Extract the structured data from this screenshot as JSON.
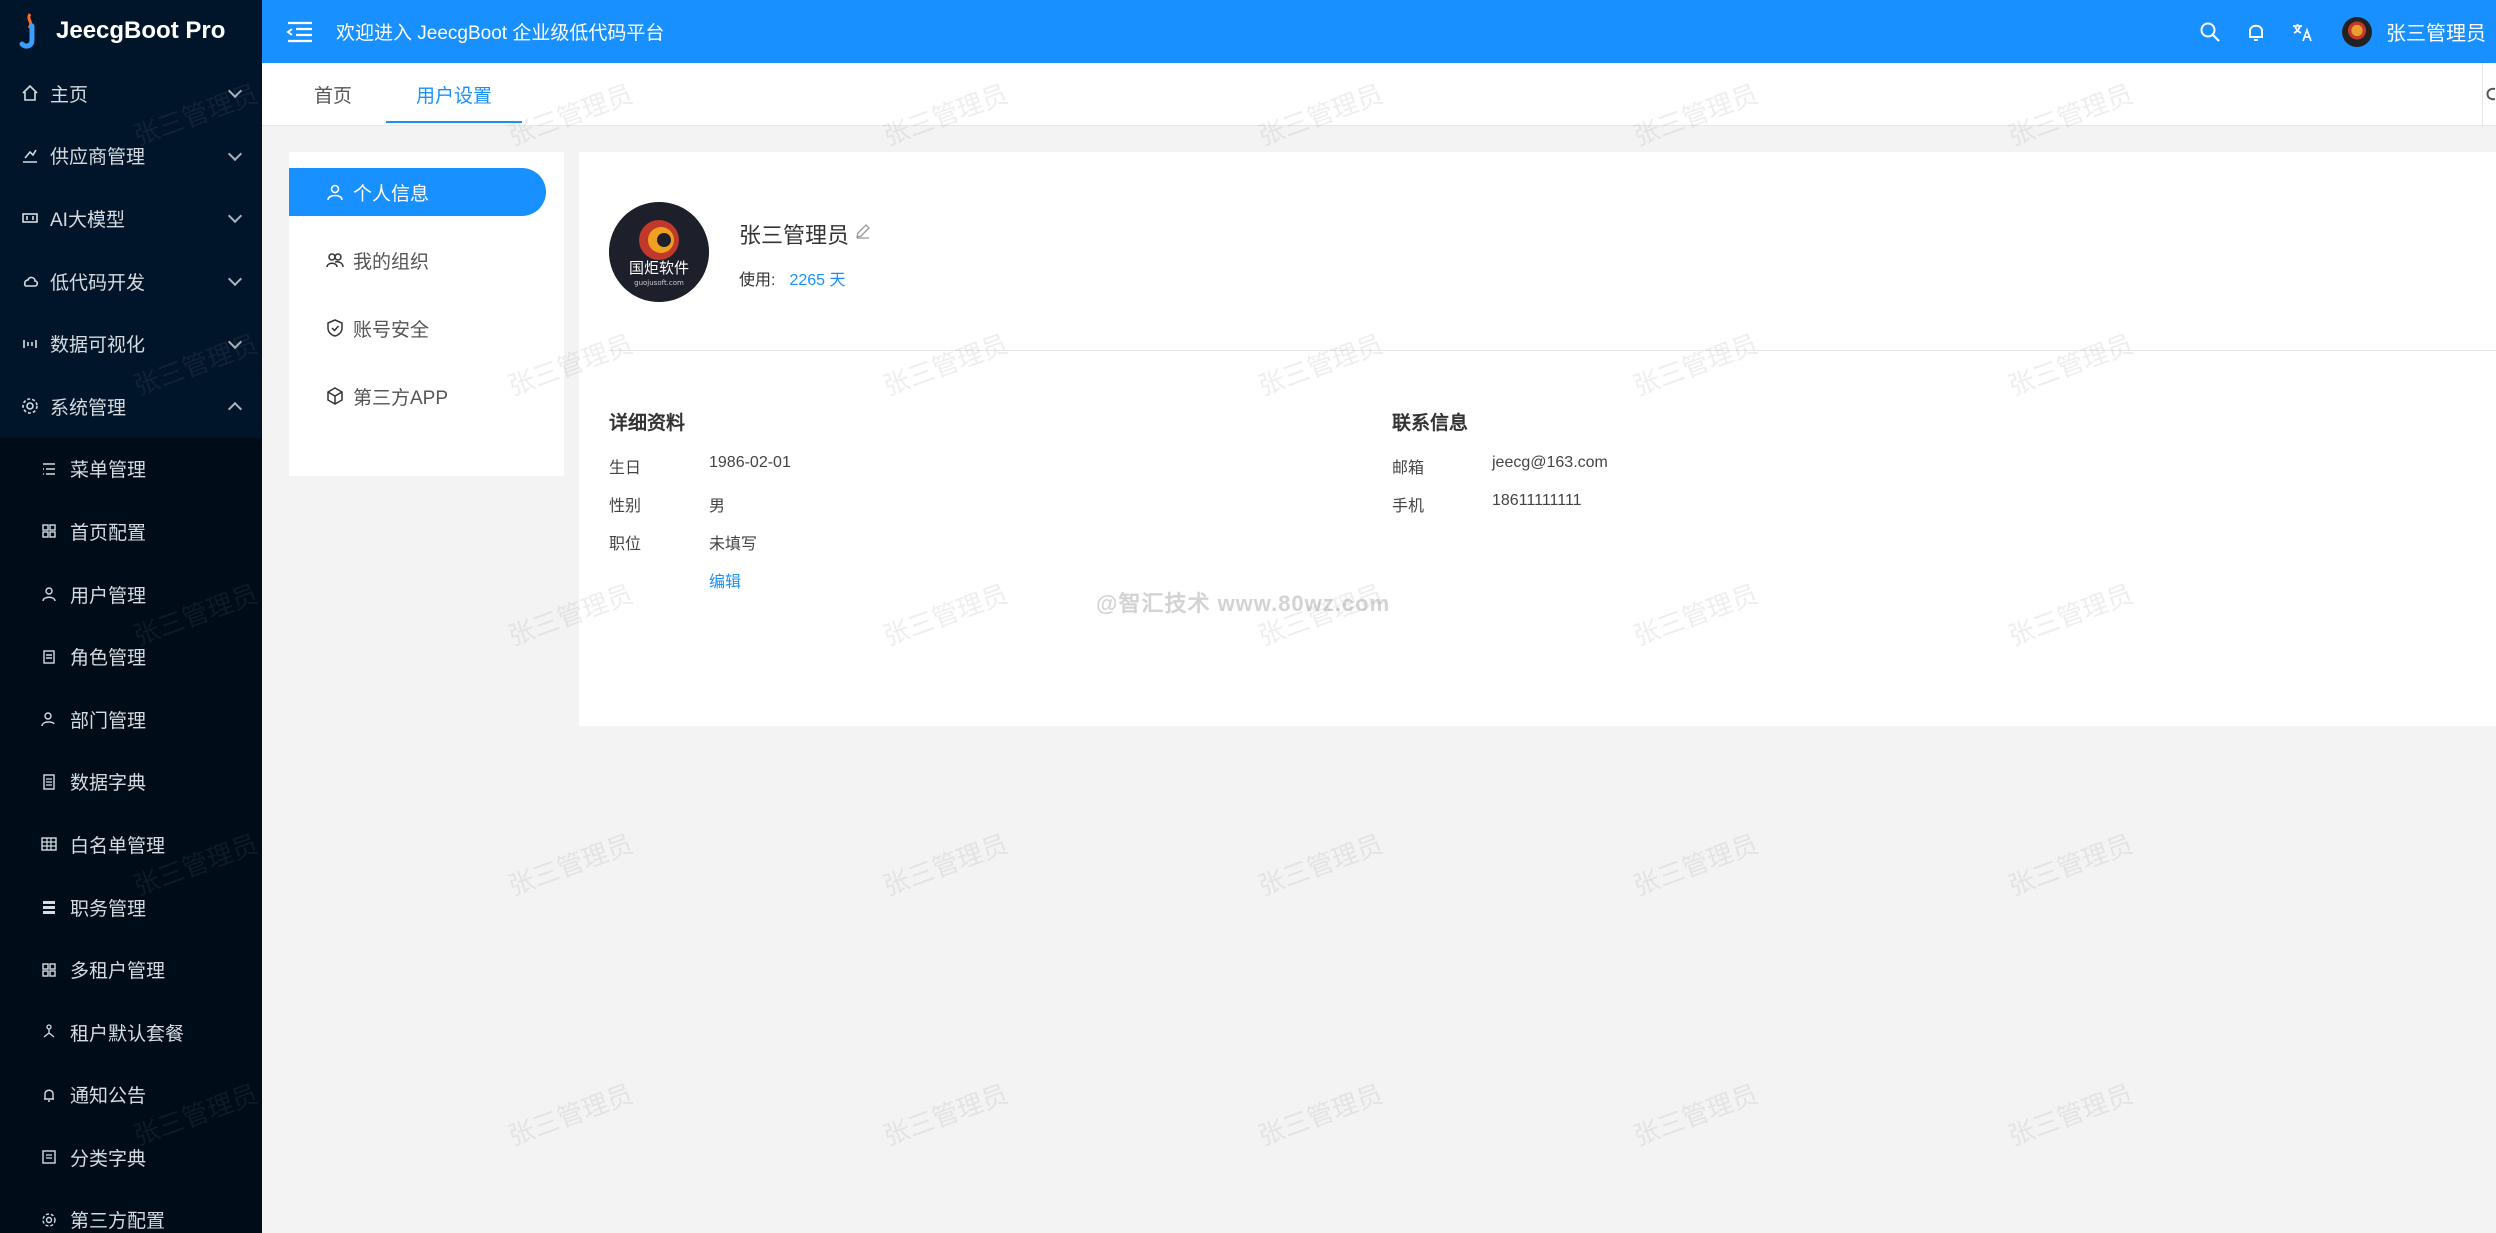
{
  "app": {
    "title": "JeecgBoot Pro"
  },
  "header": {
    "welcome": "欢迎进入 JeecgBoot 企业级低代码平台",
    "user_name": "张三管理员",
    "icons": [
      "search-icon",
      "bell-icon",
      "translate-icon"
    ]
  },
  "sidebar": {
    "items": [
      {
        "label": "主页",
        "icon": "home-icon",
        "expanded": false
      },
      {
        "label": "供应商管理",
        "icon": "supplier-icon",
        "expanded": false
      },
      {
        "label": "AI大模型",
        "icon": "ai-icon",
        "expanded": false
      },
      {
        "label": "低代码开发",
        "icon": "cloud-icon",
        "expanded": false
      },
      {
        "label": "数据可视化",
        "icon": "dataviz-icon",
        "expanded": false
      },
      {
        "label": "系统管理",
        "icon": "gear-icon",
        "expanded": true
      }
    ],
    "sub_items": [
      {
        "label": "菜单管理",
        "icon": "menu-list-icon"
      },
      {
        "label": "首页配置",
        "icon": "grid-icon"
      },
      {
        "label": "用户管理",
        "icon": "user-icon"
      },
      {
        "label": "角色管理",
        "icon": "role-icon"
      },
      {
        "label": "部门管理",
        "icon": "dept-icon"
      },
      {
        "label": "数据字典",
        "icon": "dict-icon"
      },
      {
        "label": "白名单管理",
        "icon": "table-icon"
      },
      {
        "label": "职务管理",
        "icon": "position-icon"
      },
      {
        "label": "多租户管理",
        "icon": "grid-icon"
      },
      {
        "label": "租户默认套餐",
        "icon": "tree-icon"
      },
      {
        "label": "通知公告",
        "icon": "bell-icon"
      },
      {
        "label": "分类字典",
        "icon": "category-icon"
      },
      {
        "label": "第三方配置",
        "icon": "gear-icon"
      }
    ]
  },
  "tabs": [
    {
      "label": "首页",
      "active": false
    },
    {
      "label": "用户设置",
      "active": true
    }
  ],
  "settings_nav": [
    {
      "label": "个人信息",
      "icon": "user-icon",
      "active": true
    },
    {
      "label": "我的组织",
      "icon": "team-icon",
      "active": false
    },
    {
      "label": "账号安全",
      "icon": "shield-icon",
      "active": false
    },
    {
      "label": "第三方APP",
      "icon": "cube-icon",
      "active": false
    }
  ],
  "profile": {
    "name": "张三管理员",
    "avatar_text": "国炬软件",
    "avatar_subtext": "guojusoft.com",
    "usage_label": "使用:",
    "usage_value": "2265 天"
  },
  "details": {
    "title": "详细资料",
    "rows": [
      {
        "label": "生日",
        "value": "1986-02-01"
      },
      {
        "label": "性别",
        "value": "男"
      },
      {
        "label": "职位",
        "value": "未填写"
      }
    ],
    "edit_label": "编辑"
  },
  "contact": {
    "title": "联系信息",
    "rows": [
      {
        "label": "邮箱",
        "value": "jeecg@163.com"
      },
      {
        "label": "手机",
        "value": "18611111111"
      }
    ]
  },
  "watermark": {
    "text": "张三管理员",
    "site_text": "@智汇技术 www.80wz.com"
  },
  "colors": {
    "primary": "#1890ff",
    "sidebar_bg": "#001529",
    "submenu_bg": "#000c17"
  }
}
